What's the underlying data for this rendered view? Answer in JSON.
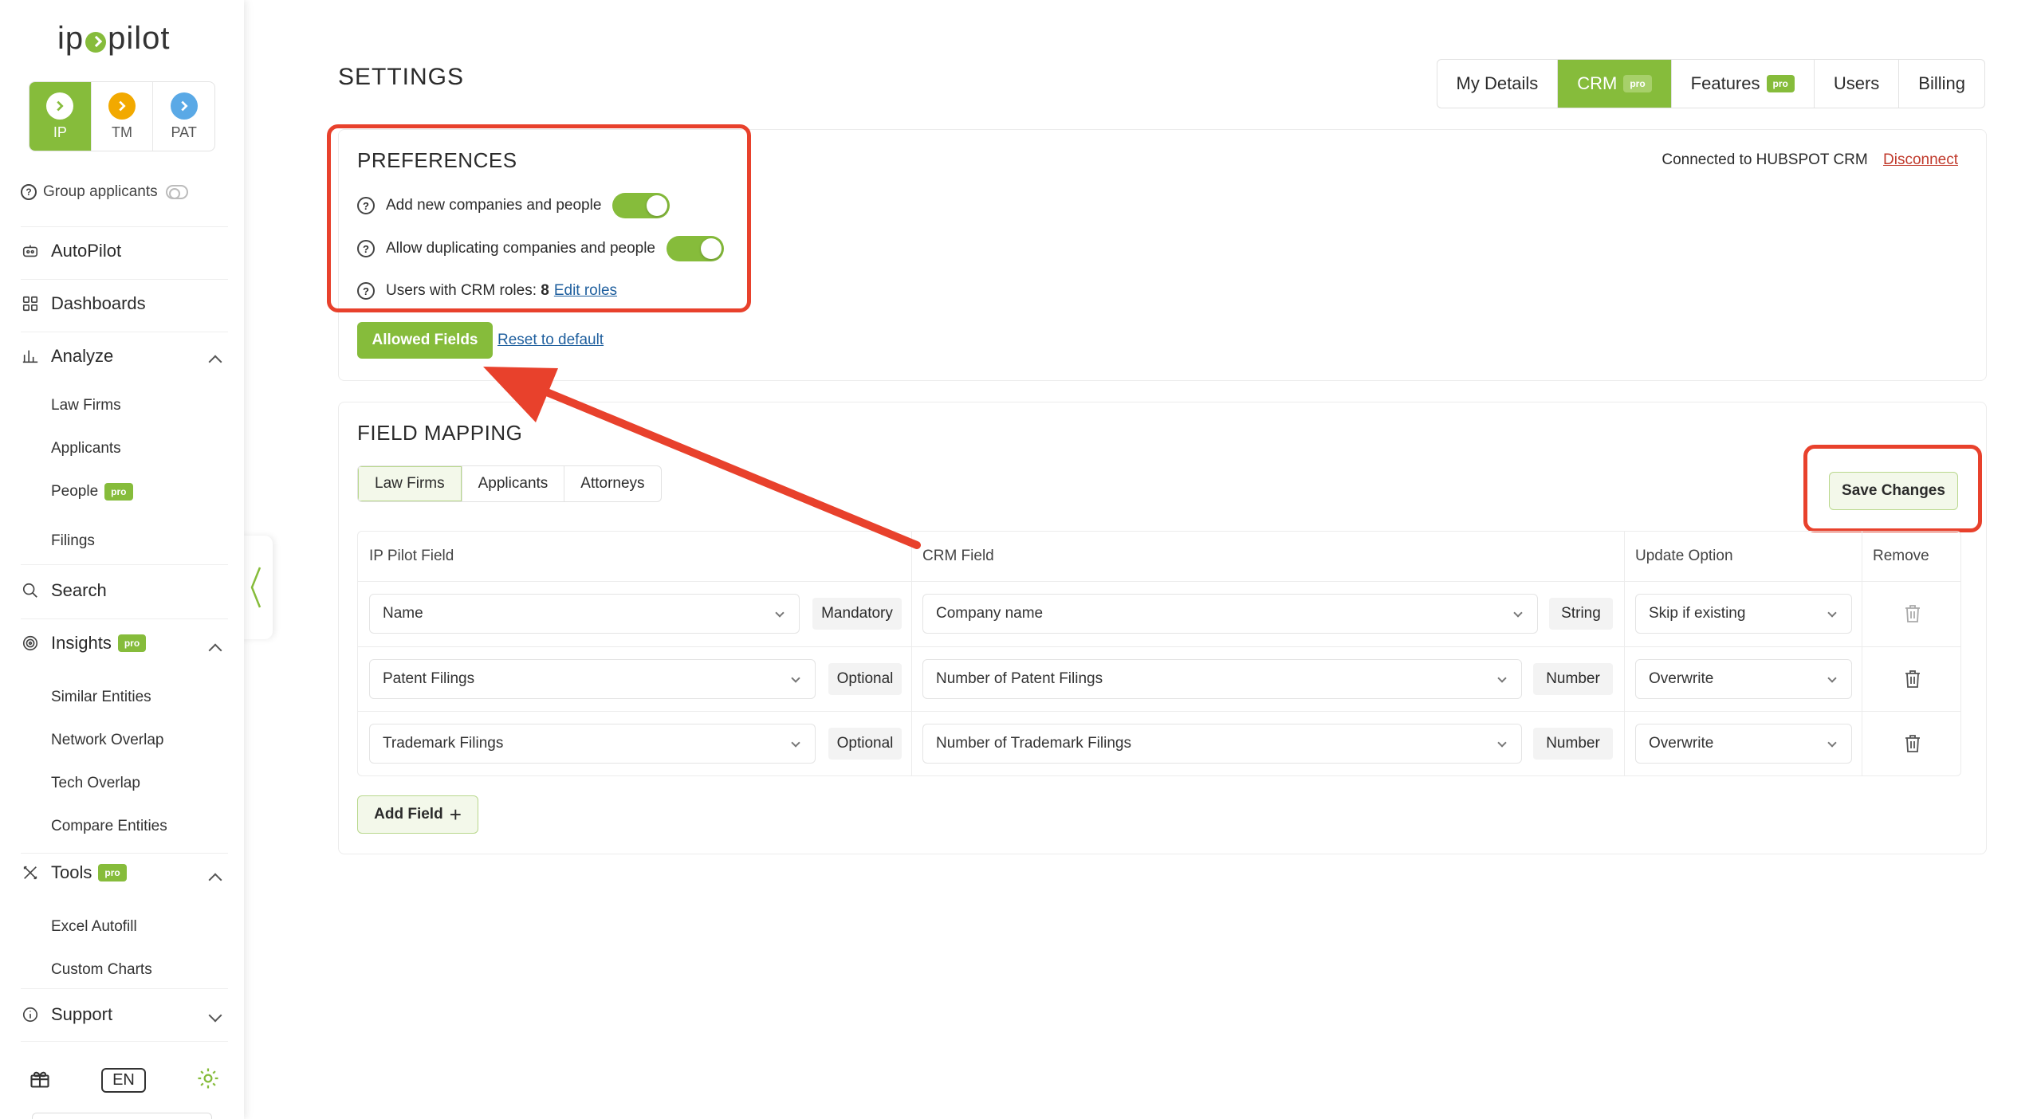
{
  "brand": {
    "logo_text_left": "ip",
    "logo_text_right": "pilot",
    "accent": "#86bc3b",
    "annotation_red": "#e8412c"
  },
  "modes": [
    {
      "label": "IP",
      "icon": "chevron-right-icon",
      "active": true,
      "color": "#86bc3b"
    },
    {
      "label": "TM",
      "icon": "chevron-right-icon",
      "active": false,
      "color": "#f2a900"
    },
    {
      "label": "PAT",
      "icon": "chevron-right-icon",
      "active": false,
      "color": "#5aa9e6"
    }
  ],
  "sidebar": {
    "group_applicants": "Group applicants",
    "autopilot": "AutoPilot",
    "dashboards": "Dashboards",
    "analyze": "Analyze",
    "analyze_items": [
      "Law Firms",
      "Applicants",
      "People",
      "Filings"
    ],
    "people_badge": "pro",
    "search": "Search",
    "insights": "Insights",
    "insights_badge": "pro",
    "insights_items": [
      "Similar Entities",
      "Network Overlap",
      "Tech Overlap",
      "Compare Entities"
    ],
    "tools": "Tools",
    "tools_badge": "pro",
    "tools_items": [
      "Excel Autofill",
      "Custom Charts"
    ],
    "support": "Support",
    "language": "EN"
  },
  "header": {
    "title": "SETTINGS",
    "tabs": [
      {
        "label": "My Details",
        "badge": ""
      },
      {
        "label": "CRM",
        "badge": "pro"
      },
      {
        "label": "Features",
        "badge": "pro"
      },
      {
        "label": "Users",
        "badge": ""
      },
      {
        "label": "Billing",
        "badge": ""
      }
    ]
  },
  "preferences": {
    "title": "PREFERENCES",
    "add_new": "Add new companies and people",
    "allow_dup": "Allow duplicating companies and people",
    "crm_roles_prefix": "Users with CRM roles: ",
    "crm_roles_count": "8",
    "edit_roles": "Edit roles",
    "allowed_fields": "Allowed Fields",
    "reset": "Reset to default",
    "connected": "Connected to HUBSPOT CRM",
    "disconnect": "Disconnect",
    "add_new_enabled": true,
    "allow_dup_enabled": true
  },
  "mapping": {
    "title": "FIELD MAPPING",
    "tabs": [
      "Law Firms",
      "Applicants",
      "Attorneys"
    ],
    "save": "Save Changes",
    "columns": [
      "IP Pilot Field",
      "CRM Field",
      "Update Option",
      "Remove"
    ],
    "rows": [
      {
        "ip_field": "Name",
        "req": "Mandatory",
        "crm_field": "Company name",
        "type": "String",
        "update": "Skip if existing"
      },
      {
        "ip_field": "Patent Filings",
        "req": "Optional",
        "crm_field": "Number of Patent Filings",
        "type": "Number",
        "update": "Overwrite"
      },
      {
        "ip_field": "Trademark Filings",
        "req": "Optional",
        "crm_field": "Number of Trademark Filings",
        "type": "Number",
        "update": "Overwrite"
      }
    ],
    "add_field": "Add Field"
  }
}
